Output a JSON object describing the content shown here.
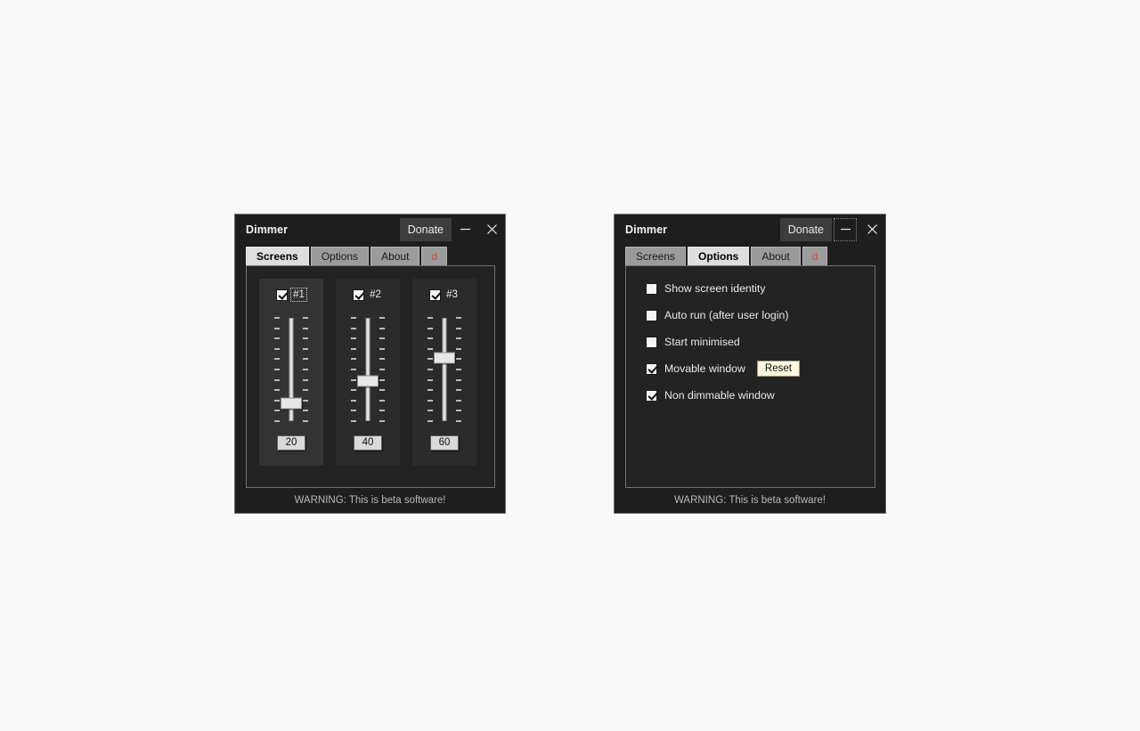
{
  "app": {
    "title": "Dimmer",
    "donate_label": "Donate",
    "minimize_icon": "minimize-icon",
    "close_icon": "close-icon",
    "status_text": "WARNING: This is beta software!"
  },
  "tabs": [
    {
      "label": "Screens"
    },
    {
      "label": "Options"
    },
    {
      "label": "About"
    },
    {
      "label": "d"
    }
  ],
  "windows": [
    {
      "name": "screens-window",
      "active_tab": "Screens"
    },
    {
      "name": "options-window",
      "active_tab": "Options"
    }
  ],
  "screens": {
    "slider_min": 0,
    "slider_max": 100,
    "tick_count": 11,
    "items": [
      {
        "label": "#1",
        "enabled": true,
        "value": "20",
        "focused": true
      },
      {
        "label": "#2",
        "enabled": true,
        "value": "40",
        "focused": false
      },
      {
        "label": "#3",
        "enabled": true,
        "value": "60",
        "focused": false
      }
    ]
  },
  "options": {
    "items": [
      {
        "label": "Show screen identity",
        "checked": false
      },
      {
        "label": "Auto run (after user login)",
        "checked": false
      },
      {
        "label": "Start minimised",
        "checked": false
      },
      {
        "label": "Movable window",
        "checked": true,
        "button": "Reset"
      },
      {
        "label": "Non dimmable window",
        "checked": true
      }
    ],
    "reset_label": "Reset"
  },
  "colors": {
    "window_bg": "#1e1e1e",
    "panel_bg": "#232323",
    "tab_active": "#dedede",
    "tab_inactive": "#9b9b9b",
    "tab_letter_color": "#d24a3a",
    "reset_button_bg": "#fbf6dc",
    "page_bg": "#faf9f9"
  }
}
